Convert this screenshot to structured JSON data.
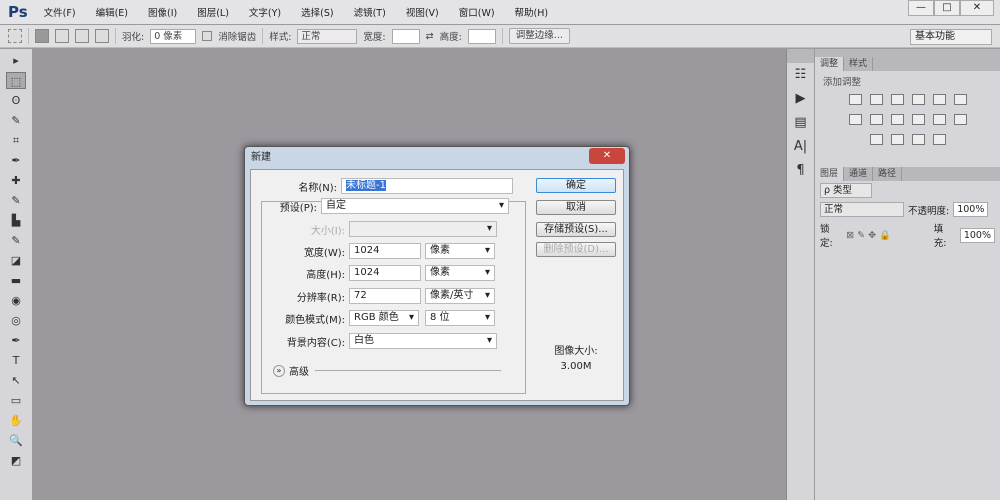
{
  "app": {
    "logo": "Ps",
    "menus": [
      "文件(F)",
      "编辑(E)",
      "图像(I)",
      "图层(L)",
      "文字(Y)",
      "选择(S)",
      "滤镜(T)",
      "视图(V)",
      "窗口(W)",
      "帮助(H)"
    ],
    "window_buttons": [
      "—",
      "□",
      "✕"
    ]
  },
  "options": {
    "feather_label": "羽化:",
    "feather_value": "0 像素",
    "antialias": "消除锯齿",
    "style_label": "样式:",
    "style_value": "正常",
    "width_label": "宽度:",
    "height_label": "高度:",
    "refine": "调整边缘...",
    "workspace": "基本功能"
  },
  "tools": [
    "▸",
    "⬚",
    "ʘ",
    "✎",
    "⌗",
    "✒",
    "✚",
    "✎",
    "▙",
    "✎",
    "◪",
    "▬",
    "◉",
    "◎",
    "✒",
    "T",
    "↖",
    "▭",
    "✋",
    "🔍",
    "◩"
  ],
  "right_icons": [
    "☷",
    "▶",
    "▤",
    "A|",
    "¶"
  ],
  "panels": {
    "adjust_tabs": [
      "调整",
      "样式"
    ],
    "add_adjust": "添加调整",
    "layer_tabs": [
      "图层",
      "通道",
      "路径"
    ],
    "kind": "ρ 类型",
    "blend": "正常",
    "opacity_label": "不透明度:",
    "opacity": "100%",
    "lock_label": "锁定:",
    "fill_label": "填充:",
    "fill": "100%"
  },
  "dialog": {
    "title": "新建",
    "close": "✕",
    "name_label": "名称(N):",
    "name_value": "未标题-1",
    "preset_label": "预设(P):",
    "preset_value": "自定",
    "size_label": "大小(I):",
    "width_label": "宽度(W):",
    "width_value": "1024",
    "width_unit": "像素",
    "height_label": "高度(H):",
    "height_value": "1024",
    "height_unit": "像素",
    "res_label": "分辨率(R):",
    "res_value": "72",
    "res_unit": "像素/英寸",
    "mode_label": "颜色模式(M):",
    "mode_value": "RGB 颜色",
    "bits": "8 位",
    "bg_label": "背景内容(C):",
    "bg_value": "白色",
    "advanced": "高级",
    "ok": "确定",
    "cancel": "取消",
    "save_preset": "存储预设(S)...",
    "delete_preset": "删除预设(D)...",
    "image_size_label": "图像大小:",
    "image_size": "3.00M"
  }
}
